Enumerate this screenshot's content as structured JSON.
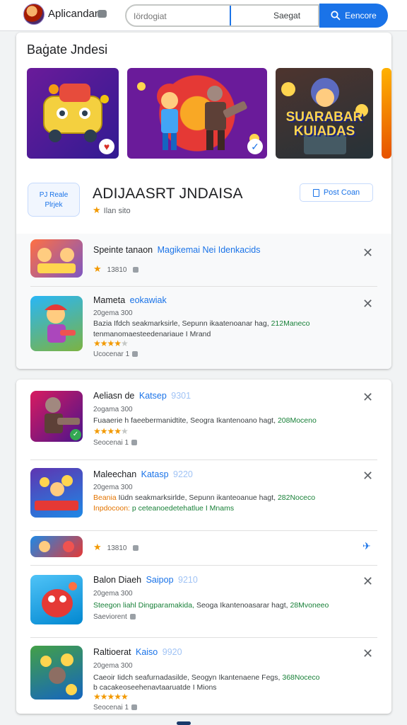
{
  "header": {
    "app_title": "Aplicandan",
    "search_placeholder": "Iördogiat",
    "search_scope": "Saegat",
    "search_button": "Eencore"
  },
  "featured": {
    "section_title": "Baġate Jndesi",
    "carousel_text": "SUARABAR KUIADAS",
    "hero_title": "ADIJAASRT JNDAISA",
    "hero_rating": "Ilan sito",
    "promo_label_line1": "PJ Reale",
    "promo_label_line2": "Plrjek",
    "post_button": "Post Coan",
    "colors": {
      "accent": "#1a73e8",
      "star": "#f29900"
    }
  },
  "card1_items": [
    {
      "name": "Speinte tanaon",
      "subname": "Magikemai Nei Idenkacids",
      "meta": "13810"
    },
    {
      "name": "Mameta",
      "subname": "eokawiak",
      "small": "20gema 300",
      "desc": "Bazia Ifdch seakmarksirle, Sepunn ikaatenoanar hag,",
      "desc_green": "212Maneco",
      "desc2": "tenmanomaesteedenariaue I Mrand",
      "meta": "Ucocenar 1"
    }
  ],
  "card2_items": [
    {
      "name": "Aeliasn de",
      "subname": "Katsep",
      "faint": "9301",
      "small": "2ogama 300",
      "desc": "Fuaaerie h faeebermanidtite, Seogra Ikantenoano hagt,",
      "desc_green": "208Moceno",
      "meta": "Seocenai 1"
    },
    {
      "name": "Maleechan",
      "subname": "Katasp",
      "faint": "9220",
      "small": "20gema 300",
      "desc_orange": "Beania",
      "desc": "Iüdn seakmarksirlde, Sepunn ikanteoanue hagt,",
      "desc_green": "282Noceco",
      "desc2_prefix": "Inpdocoon:",
      "desc2_green": "p ceteanoedetehatlue I Mnams"
    },
    {
      "meta": "13810"
    },
    {
      "name": "Balon Diaeh",
      "subname": "Saipop",
      "faint": "9210",
      "small": "20gema 300",
      "desc_green": "Steegon liahl Dingparamakida,",
      "desc": "Seoga Ikantenoasarar hagt,",
      "desc_green2": "28Mvoneeo",
      "meta": "Saeviorent"
    },
    {
      "name": "Raltioerat",
      "subname": "Kaiso",
      "faint": "9920",
      "small": "20gema 300",
      "desc": "Caeoir Iidch seafurnadasilde, Seogyn Ikantenaene Fegs,",
      "desc_green": "368Noceco",
      "desc2": "b cacakeoseehenavtaaruatde I Mions",
      "meta": "Seocenai 1"
    }
  ]
}
